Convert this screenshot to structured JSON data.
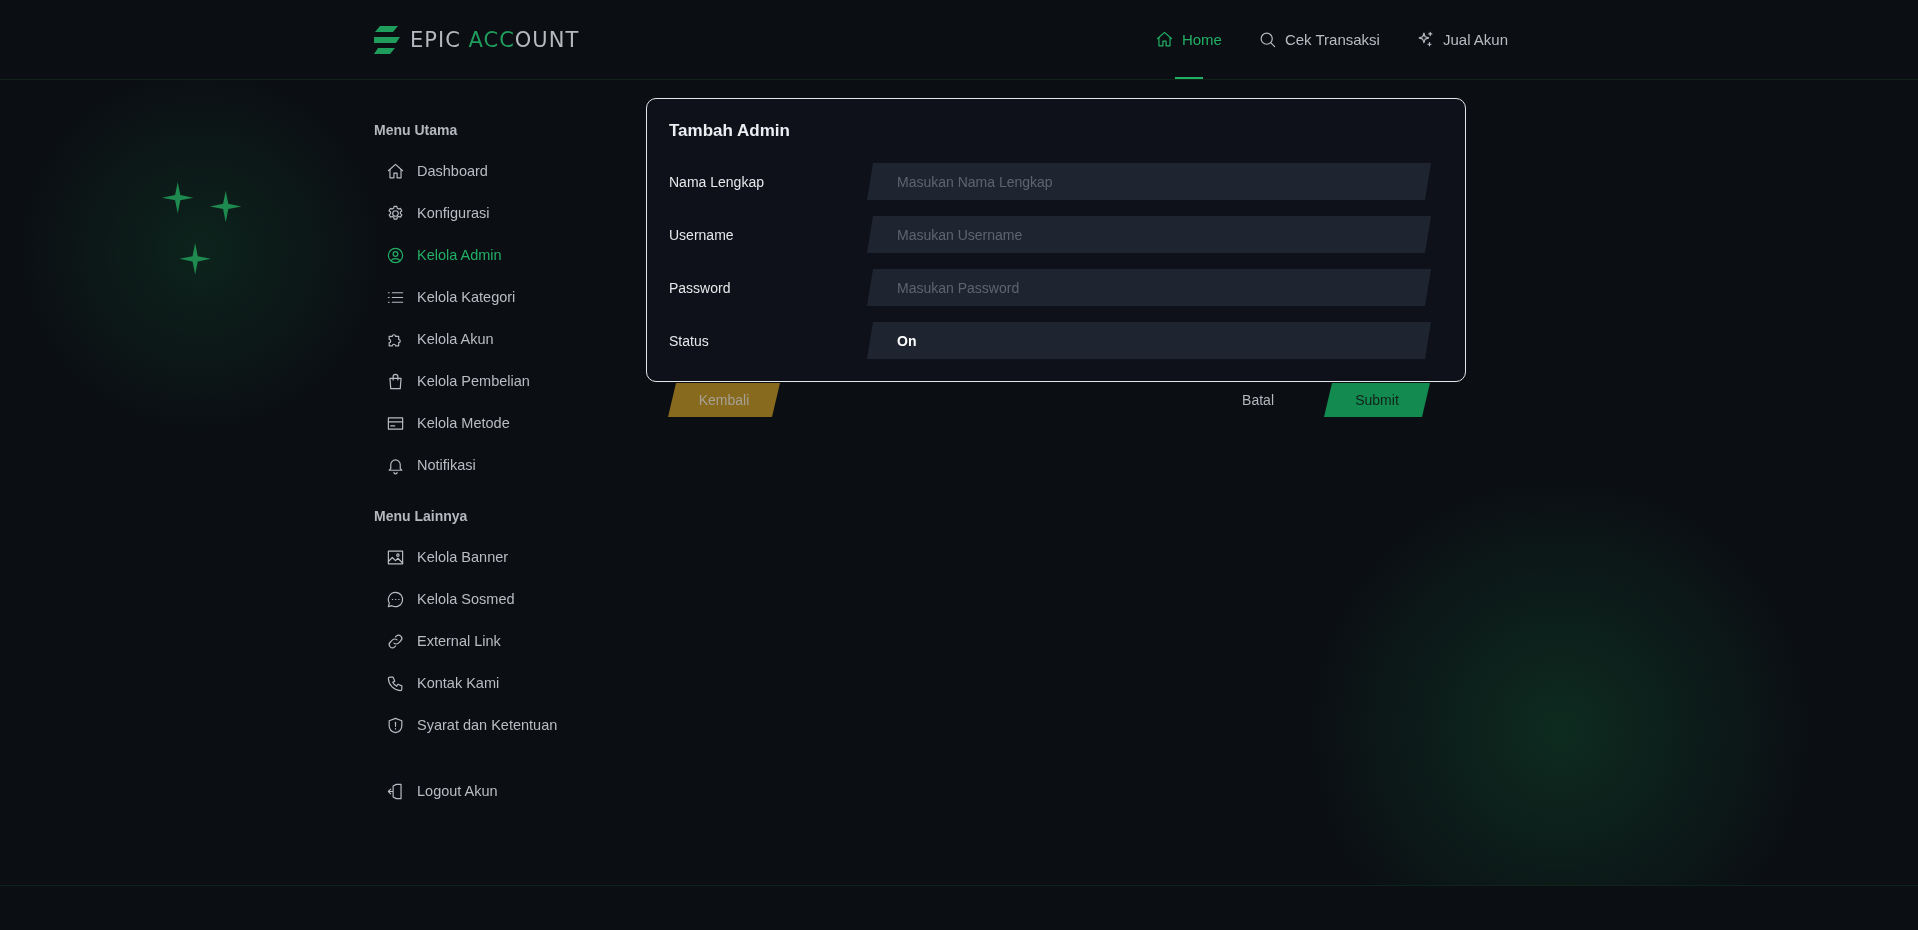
{
  "logo": {
    "parts": [
      {
        "text": "EPIC ",
        "accent": false
      },
      {
        "text": "ACC",
        "accent": true
      },
      {
        "text": "OUNT",
        "accent": false
      }
    ]
  },
  "nav": [
    {
      "label": "Home",
      "selected": true
    },
    {
      "label": "Cek Transaksi",
      "selected": false
    },
    {
      "label": "Jual Akun",
      "selected": false
    }
  ],
  "sidebar": {
    "sections": [
      {
        "title": "Menu Utama",
        "items": [
          {
            "label": "Dashboard",
            "selected": false
          },
          {
            "label": "Konfigurasi",
            "selected": false
          },
          {
            "label": "Kelola Admin",
            "selected": true
          },
          {
            "label": "Kelola Kategori",
            "selected": false
          },
          {
            "label": "Kelola Akun",
            "selected": false
          },
          {
            "label": "Kelola Pembelian",
            "selected": false
          },
          {
            "label": "Kelola Metode",
            "selected": false
          },
          {
            "label": "Notifikasi",
            "selected": false
          }
        ]
      },
      {
        "title": "Menu Lainnya",
        "items": [
          {
            "label": "Kelola Banner",
            "selected": false
          },
          {
            "label": "Kelola Sosmed",
            "selected": false
          },
          {
            "label": "External Link",
            "selected": false
          },
          {
            "label": "Kontak Kami",
            "selected": false
          },
          {
            "label": "Syarat dan Ketentuan",
            "selected": false
          }
        ]
      }
    ],
    "logout": "Logout Akun"
  },
  "form": {
    "title": "Tambah Admin",
    "fields": [
      {
        "label": "Nama Lengkap",
        "kind": "input",
        "placeholder": "Masukan Nama Lengkap"
      },
      {
        "label": "Username",
        "kind": "input",
        "placeholder": "Masukan Username"
      },
      {
        "label": "Password",
        "kind": "input",
        "placeholder": "Masukan Password"
      },
      {
        "label": "Status",
        "kind": "select",
        "value": "On"
      }
    ]
  },
  "buttons": {
    "back": "Kembali",
    "cancel": "Batal",
    "submit": "Submit"
  }
}
